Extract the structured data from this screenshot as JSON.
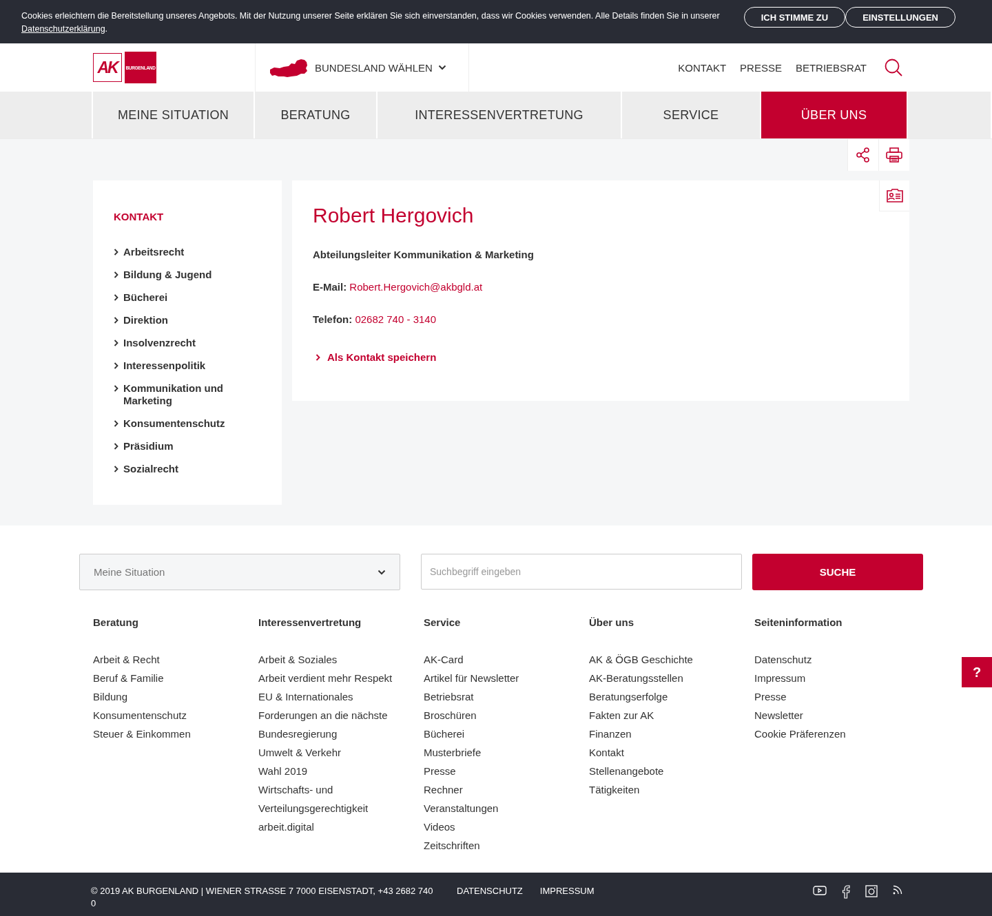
{
  "cookie_banner": {
    "text": "Cookies erleichtern die Bereitstellung unseres Angebots. Mit der Nutzung unserer Seite erklären Sie sich einverstanden, dass wir Cookies verwenden. Alle Details finden Sie in unserer",
    "link": "Datenschutzerklärung",
    "after_link": ".",
    "buttons": [
      "ICH STIMME ZU",
      "EINSTELLUNGEN"
    ]
  },
  "header": {
    "logo": {
      "mark": "AK",
      "region": "BURGENLAND"
    },
    "region_select": "BUNDESLAND WÄHLEN",
    "links": [
      "KONTAKT",
      "PRESSE",
      "BETRIEBSRAT"
    ]
  },
  "main_nav": [
    {
      "label": "MEINE SITUATION",
      "selected": false
    },
    {
      "label": "BERATUNG",
      "selected": false
    },
    {
      "label": "INTERESSENVERTRETUNG",
      "selected": false
    },
    {
      "label": "SERVICE",
      "selected": false
    },
    {
      "label": "ÜBER UNS",
      "selected": true
    }
  ],
  "sidebar": {
    "title": "KONTAKT",
    "items": [
      "Arbeitsrecht",
      "Bildung & Jugend",
      "Bücherei",
      "Direktion",
      "Insolvenzrecht",
      "Interessenpolitik",
      "Kommunikation und Marketing",
      "Konsumentenschutz",
      "Präsidium",
      "Sozialrecht"
    ]
  },
  "contact": {
    "name": "Robert Hergovich",
    "position": "Abteilungsleiter Kommunikation & Marketing",
    "fields": [
      {
        "label": "E-Mail:",
        "value": "Robert.Hergovich@akbgld.at"
      },
      {
        "label": "Telefon:",
        "value": "02682 740 - 3140"
      }
    ],
    "save_link": "Als Kontakt speichern"
  },
  "footer_search": {
    "category": "Meine Situation",
    "placeholder": "Suchbegriff eingeben",
    "button": "SUCHE"
  },
  "footer_columns": [
    {
      "title": "Beratung",
      "links": [
        "Arbeit & Recht",
        "Beruf & Familie",
        "Bildung",
        "Konsumentenschutz",
        "Steuer & Einkommen"
      ]
    },
    {
      "title": "Interessenvertretung",
      "links": [
        "Arbeit & Soziales",
        "Arbeit verdient mehr Respekt",
        "EU & Internationales",
        "Forderungen an die nächste Bundesregierung",
        "Umwelt & Verkehr",
        "Wahl 2019",
        "Wirtschafts- und Verteilungsgerechtigkeit",
        "arbeit.digital"
      ]
    },
    {
      "title": "Service",
      "links": [
        "AK-Card",
        "Artikel für Newsletter",
        "Betriebsrat",
        "Broschüren",
        "Bücherei",
        "Musterbriefe",
        "Presse",
        "Rechner",
        "Veranstaltungen",
        "Videos",
        "Zeitschriften"
      ]
    },
    {
      "title": "Über uns",
      "links": [
        "AK & ÖGB Geschichte",
        "AK-Beratungsstellen",
        "Beratungserfolge",
        "Fakten zur AK",
        "Finanzen",
        "Kontakt",
        "Stellenangebote",
        "Tätigkeiten"
      ]
    },
    {
      "title": "Seiteninformation",
      "links": [
        "Datenschutz",
        "Impressum",
        "Presse",
        "Newsletter",
        "Cookie Präferenzen"
      ]
    }
  ],
  "bottom_bar": {
    "copyright": "© 2019 AK BURGENLAND | WIENER STRASSE 7 7000 EISENSTADT, +43 2682 740 0",
    "links": [
      "DATENSCHUTZ",
      "IMPRESSUM"
    ]
  },
  "help_button": "?"
}
